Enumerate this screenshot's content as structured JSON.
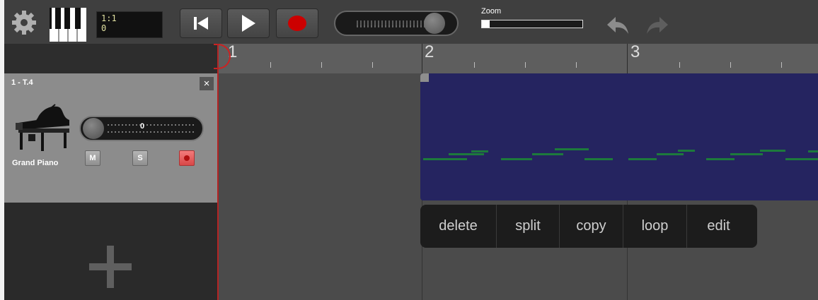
{
  "toolbar": {
    "settings_icon": "gear-icon",
    "keyboard_icon": "piano-keys-icon",
    "position": {
      "bar_beat": "1:1",
      "tick": "0"
    },
    "rewind_icon": "skip-to-start-icon",
    "play_icon": "play-icon",
    "record_icon": "record-icon",
    "zoom": {
      "label": "Zoom",
      "level": 0.08
    },
    "undo_icon": "undo-icon",
    "redo_icon": "redo-icon"
  },
  "ruler": {
    "bars": [
      "1",
      "2",
      "3"
    ]
  },
  "track": {
    "title": "1 - T.4",
    "close_label": "×",
    "instrument_icon": "grand-piano-icon",
    "instrument_name": "Grand Piano",
    "volume_value": "0",
    "mute_label": "M",
    "solo_label": "S",
    "record_arm_icon": "record-arm-icon"
  },
  "add_track_icon": "plus-icon",
  "context_menu": {
    "items": [
      "delete",
      "split",
      "copy",
      "loop",
      "edit"
    ]
  },
  "colors": {
    "region": "#252460",
    "notes": "#1d7a3c",
    "playhead": "#b42424",
    "record": "#cc0000"
  }
}
